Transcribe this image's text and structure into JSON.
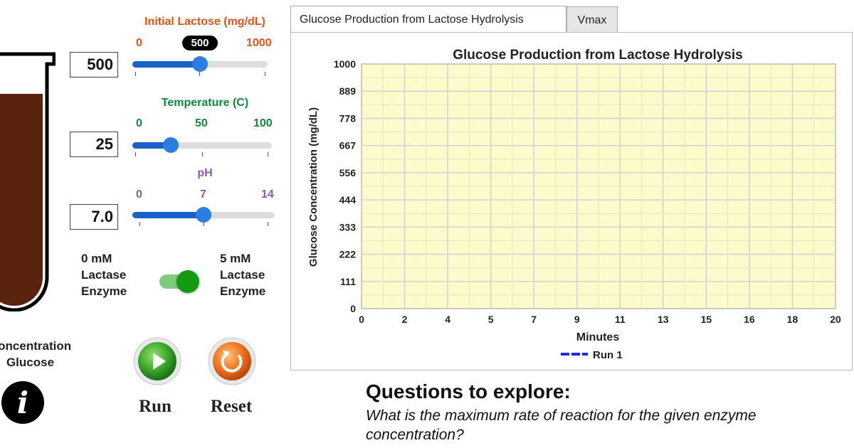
{
  "tube": {
    "label_line1": "Concentration",
    "label_line2": "Glucose",
    "fill_color": "#5a230e"
  },
  "info_icon": "i",
  "sliders": {
    "lactose": {
      "title": "Initial Lactose (mg/dL)",
      "min": "0",
      "max": "1000",
      "value": "500",
      "bubble": "500",
      "color": "#e0541a",
      "fraction": 0.5
    },
    "temperature": {
      "title": "Temperature (C)",
      "min": "0",
      "mid": "50",
      "max": "100",
      "value": "25",
      "color": "#0f8a3c",
      "fraction": 0.25
    },
    "ph": {
      "title": "pH",
      "min": "0",
      "mid": "7",
      "max": "14",
      "value": "7.0",
      "color": "#8e5aa8",
      "fraction": 0.5
    }
  },
  "toggle": {
    "left_line1": "0 mM",
    "left_line2": "Lactase",
    "left_line3": "Enzyme",
    "right_line1": "5 mM",
    "right_line2": "Lactase",
    "right_line3": "Enzyme",
    "state": "on"
  },
  "buttons": {
    "run": "Run",
    "reset": "Reset"
  },
  "tabs": [
    "Glucose Production from Lactose Hydrolysis",
    "Vmax"
  ],
  "chart_data": {
    "type": "line",
    "title": "Glucose Production from Lactose Hydrolysis",
    "xlabel": "Minutes",
    "ylabel": "Glucose Concentration (mg/dL)",
    "x_ticks": [
      "0",
      "2",
      "4",
      "5",
      "7",
      "9",
      "11",
      "13",
      "15",
      "16",
      "18",
      "20"
    ],
    "y_ticks": [
      "0",
      "111",
      "222",
      "333",
      "444",
      "556",
      "667",
      "778",
      "889",
      "1000"
    ],
    "xlim": [
      0,
      20
    ],
    "ylim": [
      0,
      1000
    ],
    "grid": true,
    "plot_background": "#fdfbcb",
    "legend_position": "bottom-center",
    "series": [
      {
        "name": "Run 1",
        "color": "#1a2fd6",
        "x": [],
        "y": []
      }
    ]
  },
  "questions": {
    "title": "Questions to explore:",
    "text": "What is the maximum rate of reaction for the given enzyme concentration?"
  }
}
